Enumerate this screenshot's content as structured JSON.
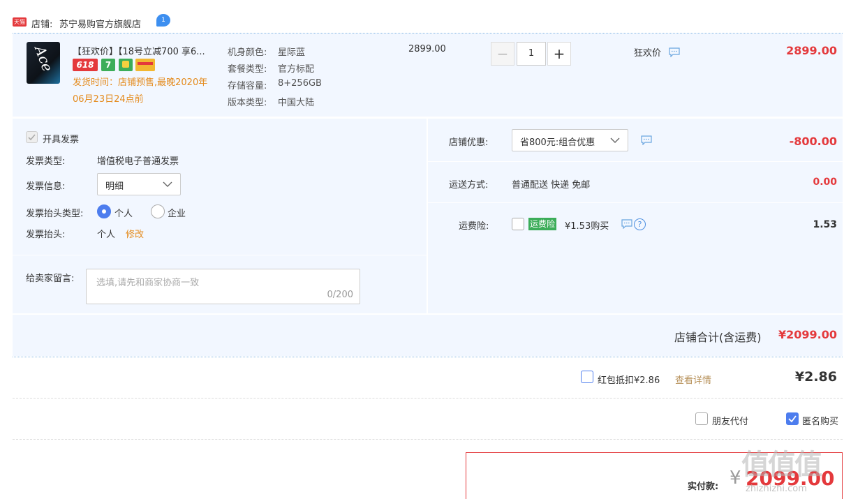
{
  "colors": {
    "accent": "#e4393c",
    "blue": "#4d7dee",
    "panel": "#f2f7ff",
    "orange": "#e48b1d",
    "green": "#3cad59"
  },
  "store": {
    "badge": "天猫",
    "label": "店铺:",
    "name": "苏宁易购官方旗舰店",
    "msg_count": "1"
  },
  "product": {
    "title": "【狂欢价】【18号立减700 享6...",
    "image_text": "Ace",
    "tags": [
      "618",
      "7"
    ],
    "ship_line1": "发货时间：店铺预售,最晚2020年",
    "ship_line2": "06月23日24点前",
    "specs": [
      {
        "k": "机身颜色:",
        "v": "星际蓝"
      },
      {
        "k": "套餐类型:",
        "v": "官方标配"
      },
      {
        "k": "存储容量:",
        "v": "8+256GB"
      },
      {
        "k": "版本类型:",
        "v": "中国大陆"
      }
    ],
    "unit_price": "2899.00",
    "qty": "1",
    "promo": "狂欢价",
    "subtotal": "2899.00"
  },
  "invoice": {
    "open_label": "开具发票",
    "type_label": "发票类型:",
    "type_value": "增值税电子普通发票",
    "info_label": "发票信息:",
    "info_value": "明细",
    "head_type_label": "发票抬头类型:",
    "opt_personal": "个人",
    "opt_company": "企业",
    "head_label": "发票抬头:",
    "head_value": "个人",
    "edit": "修改"
  },
  "message": {
    "label": "给卖家留言:",
    "placeholder": "选填,请先和商家协商一致",
    "counter": "0/200"
  },
  "discount": {
    "label": "店铺优惠:",
    "value": "省800元:组合优惠",
    "amount": "-800.00"
  },
  "shipping": {
    "label": "运送方式:",
    "value": "普通配送 快递 免邮",
    "amount": "0.00"
  },
  "insurance": {
    "label": "运费险:",
    "badge": "运费险",
    "text": "¥1.53购买",
    "help": "?",
    "amount": "1.53"
  },
  "store_total": {
    "label": "店铺合计(含运费)",
    "amount": "¥2099.00"
  },
  "redpacket": {
    "label": "红包抵扣¥2.86",
    "link": "查看详情",
    "amount": "¥2.86"
  },
  "options": {
    "friend_pay": "朋友代付",
    "anonymous": "匿名购买"
  },
  "pay": {
    "label": "实付款:",
    "currency": "¥",
    "amount": "2099.00"
  },
  "watermark": "值值值",
  "watermark_url": "zhizhizhi.com"
}
